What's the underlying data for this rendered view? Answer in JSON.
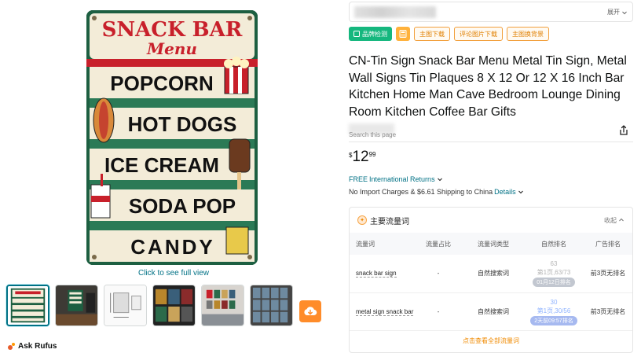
{
  "gallery": {
    "main_image": {
      "header_line1": "SNACK BAR",
      "header_line2": "Menu",
      "items": [
        "POPCORN",
        "HOT DOGS",
        "ICE CREAM",
        "SODA POP",
        "CANDY"
      ]
    },
    "full_view_link": "Click to see full view",
    "thumbnails": [
      {
        "name": "snack-bar-menu"
      },
      {
        "name": "room-scene-dark"
      },
      {
        "name": "dimensions-diagram"
      },
      {
        "name": "sign-collection-grid"
      },
      {
        "name": "wall-display-scene"
      },
      {
        "name": "many-signs-grid"
      }
    ],
    "more_icon": "cloud-download-icon"
  },
  "rufus": {
    "label": "Ask Rufus"
  },
  "top_bar": {
    "expand_label": "展开"
  },
  "tools": {
    "brand_check": "品牌检测",
    "main_image_download": "主图下载",
    "review_image_download": "评论图片下载",
    "main_image_bg": "主图换背景"
  },
  "product": {
    "title": "CN-Tin Sign Snack Bar Menu Metal Tin Sign, Metal Wall Signs Tin Plaques 8 X 12 Or 12 X 16 Inch Bar Kitchen Home Man Cave Bedroom Lounge Dining Room Kitchen Coffee Bar Gifts",
    "search_page_label": "Search this page",
    "price": {
      "currency": "$",
      "whole": "12",
      "fraction": "99"
    },
    "returns_free": "FREE",
    "returns_text": "International Returns",
    "shipping_text": "No Import Charges & $6.61 Shipping to China",
    "details_link": "Details"
  },
  "traffic": {
    "title": "主要流量词",
    "collapse_label": "收起",
    "columns": [
      "流量词",
      "流量占比",
      "流量词类型",
      "自然排名",
      "广告排名"
    ],
    "rows": [
      {
        "keyword": "snack bar sign",
        "share": "-",
        "type": "自然搜索词",
        "rank_num": "63",
        "rank_detail": "第1页,63/73",
        "rank_badge": "01月12日排名",
        "ad_rank": "前3页无排名"
      },
      {
        "keyword": "metal sign snack bar",
        "share": "-",
        "type": "自然搜索词",
        "rank_num": "30",
        "rank_detail": "第1页,30/56",
        "rank_badge": "2天前09:57排名",
        "ad_rank": "前3页无排名"
      }
    ],
    "view_all": "点击查看全部流量词"
  },
  "colors": {
    "link": "#007185",
    "accent_green": "#15b77e",
    "accent_orange": "#f08a00",
    "sign_green": "#1d5f41",
    "sign_red": "#c8202b"
  }
}
